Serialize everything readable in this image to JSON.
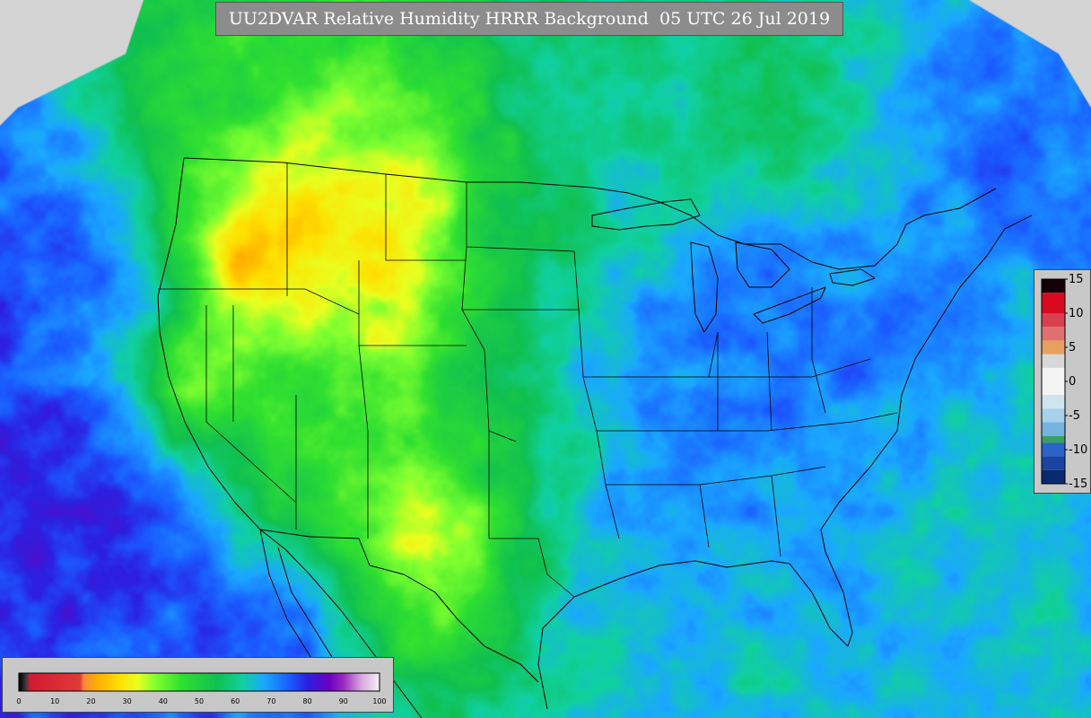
{
  "title": "UU2DVAR Relative Humidity HRRR Background  05 UTC 26 Jul 2019",
  "legend_bottom": {
    "labels": [
      "0",
      "10",
      "20",
      "30",
      "40",
      "50",
      "60",
      "70",
      "80",
      "90",
      "100"
    ],
    "range": [
      0,
      100
    ],
    "stops": [
      {
        "v": 0,
        "c": "#000000"
      },
      {
        "v": 2,
        "c": "#3a3a3a"
      },
      {
        "v": 3,
        "c": "#d11a30"
      },
      {
        "v": 17,
        "c": "#e23a3a"
      },
      {
        "v": 18,
        "c": "#f58a3a"
      },
      {
        "v": 22,
        "c": "#ffb000"
      },
      {
        "v": 28,
        "c": "#ffe000"
      },
      {
        "v": 33,
        "c": "#e8ff20"
      },
      {
        "v": 38,
        "c": "#80ff30"
      },
      {
        "v": 45,
        "c": "#30e030"
      },
      {
        "v": 55,
        "c": "#10c050"
      },
      {
        "v": 62,
        "c": "#10d0a0"
      },
      {
        "v": 68,
        "c": "#1aa8ff"
      },
      {
        "v": 75,
        "c": "#1a5cff"
      },
      {
        "v": 80,
        "c": "#2c20e0"
      },
      {
        "v": 86,
        "c": "#6a00c0"
      },
      {
        "v": 90,
        "c": "#9a2ac0"
      },
      {
        "v": 95,
        "c": "#d8a8e0"
      },
      {
        "v": 100,
        "c": "#f2f2f2"
      }
    ]
  },
  "legend_right": {
    "labels": [
      "15",
      "10",
      "5",
      "0",
      "-5",
      "-10",
      "-15"
    ],
    "range": [
      -15,
      15
    ],
    "bands": [
      {
        "from": 15,
        "to": 13,
        "c": "#150008"
      },
      {
        "from": 13,
        "to": 10,
        "c": "#d80a20"
      },
      {
        "from": 10,
        "to": 8,
        "c": "#d84050"
      },
      {
        "from": 8,
        "to": 6,
        "c": "#e07070"
      },
      {
        "from": 6,
        "to": 4,
        "c": "#e8a060"
      },
      {
        "from": 4,
        "to": 2,
        "c": "#d8d8d8"
      },
      {
        "from": 2,
        "to": -2,
        "c": "#f4f4f4"
      },
      {
        "from": -2,
        "to": -4,
        "c": "#d0e4f0"
      },
      {
        "from": -4,
        "to": -6,
        "c": "#a6d2ea"
      },
      {
        "from": -6,
        "to": -8,
        "c": "#74b4e0"
      },
      {
        "from": -8,
        "to": -9,
        "c": "#3aa060"
      },
      {
        "from": -9,
        "to": -11,
        "c": "#2a64c8"
      },
      {
        "from": -11,
        "to": -13,
        "c": "#1a44a0"
      },
      {
        "from": -13,
        "to": -15,
        "c": "#0a2a70"
      }
    ]
  },
  "map": {
    "background": "#d4d4d4",
    "ocean_blue": "#1a6cf0",
    "ocean_purple": "#8a2ac0",
    "land_blue": "#2a3ae0",
    "land_green": "#20d040",
    "land_yellow": "#f0e000",
    "land_orange": "#f5a020",
    "land_red": "#d81a3a",
    "border_color": "#000000"
  }
}
